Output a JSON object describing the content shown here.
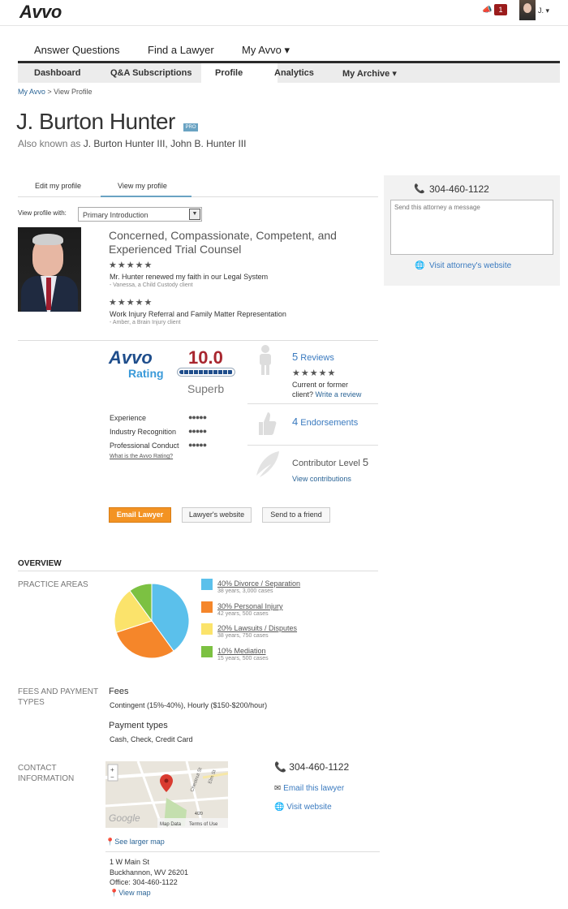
{
  "header": {
    "logo": "Avvo",
    "notification_count": "1",
    "user_label": "J. ▾"
  },
  "main_nav": {
    "items": [
      "Answer Questions",
      "Find a Lawyer",
      "My Avvo ▾"
    ],
    "active": "My Avvo"
  },
  "sub_nav": {
    "items": [
      "Dashboard",
      "Q&A Subscriptions",
      "Profile",
      "Analytics",
      "My Archive ▾"
    ],
    "active": "Profile"
  },
  "breadcrumb": {
    "parent": "My Avvo",
    "separator": " > ",
    "current": "View Profile"
  },
  "profile": {
    "name": "J. Burton Hunter",
    "pro_badge": "PRO",
    "aka_prefix": "Also known as ",
    "aka_names": "J. Burton Hunter III, John B. Hunter III"
  },
  "profile_tabs": [
    "Edit my profile",
    "View my profile"
  ],
  "view_with": {
    "label": "View profile with:",
    "selected": "Primary Introduction"
  },
  "intro": {
    "title": "Concerned, Compassionate, Competent, and Experienced Trial Counsel",
    "reviews": [
      {
        "stars": "★★★★★",
        "text": "Mr. Hunter renewed my faith in our Legal System",
        "author": "- Vanessa, a Child Custody client"
      },
      {
        "stars": "★★★★★",
        "text": "Work Injury Referral and Family Matter Representation",
        "author": "- Amber, a Brain Injury client"
      }
    ]
  },
  "rating": {
    "logo": "Avvo",
    "word": "Rating",
    "score": "10.0",
    "score_fraction": 1.0,
    "label": "Superb",
    "factors": [
      {
        "name": "Experience",
        "dots": "●●●●●"
      },
      {
        "name": "Industry Recognition",
        "dots": "●●●●●"
      },
      {
        "name": "Professional Conduct",
        "dots": "●●●●●"
      }
    ],
    "what_link": "What is the Avvo Rating?"
  },
  "stats": {
    "reviews_count": "5",
    "reviews_label": " Reviews",
    "reviews_stars": "★★★★★",
    "reviews_cta_prefix": "Current or former",
    "reviews_cta_client": "client? ",
    "reviews_cta_link": "Write a review",
    "endorsements_count": "4",
    "endorsements_label": " Endorsements",
    "contributor_label": "Contributor Level ",
    "contributor_level": "5",
    "contributions_link": "View contributions"
  },
  "actions": {
    "email": "Email Lawyer",
    "website": "Lawyer's website",
    "send": "Send to a friend"
  },
  "contact_card": {
    "phone": "304-460-1122",
    "message_placeholder": "Send this attorney a message",
    "website_link": "Visit attorney's website"
  },
  "overview": {
    "heading": "OVERVIEW",
    "practice_label": "PRACTICE AREAS",
    "chart_data": {
      "type": "pie",
      "slices": [
        {
          "label": "40% Divorce / Separation",
          "value": 40,
          "color": "#5bc0eb",
          "detail": "38 years, 3,000 cases"
        },
        {
          "label": "30% Personal Injury",
          "value": 30,
          "color": "#f5862a",
          "detail": "42 years, 500 cases"
        },
        {
          "label": "20% Lawsuits / Disputes",
          "value": 20,
          "color": "#fbe36b",
          "detail": "38 years, 750 cases"
        },
        {
          "label": "10% Mediation",
          "value": 10,
          "color": "#7cc142",
          "detail": "15 years, 500 cases"
        }
      ]
    },
    "fees_label": "FEES AND PAYMENT TYPES",
    "fees_heading": "Fees",
    "fees_text": "Contingent (15%-40%), Hourly ($150-$200/hour)",
    "payment_heading": "Payment types",
    "payment_text": "Cash, Check, Credit Card",
    "contact_label": "CONTACT INFORMATION",
    "contact_phone": "304-460-1122",
    "contact_email": "Email this lawyer",
    "contact_website": "Visit website",
    "larger_map": "See larger map",
    "map_google": "Google",
    "map_data": "Map Data",
    "map_terms": "Terms of Use",
    "map_scale": "4/20",
    "map_street_1": "Chestnut St",
    "map_street_2": "Elm St",
    "address_line1": "1 W Main St",
    "address_line2": "Buckhannon, WV 26201",
    "address_office": "Office: 304-460-1122",
    "view_map": "View map"
  }
}
